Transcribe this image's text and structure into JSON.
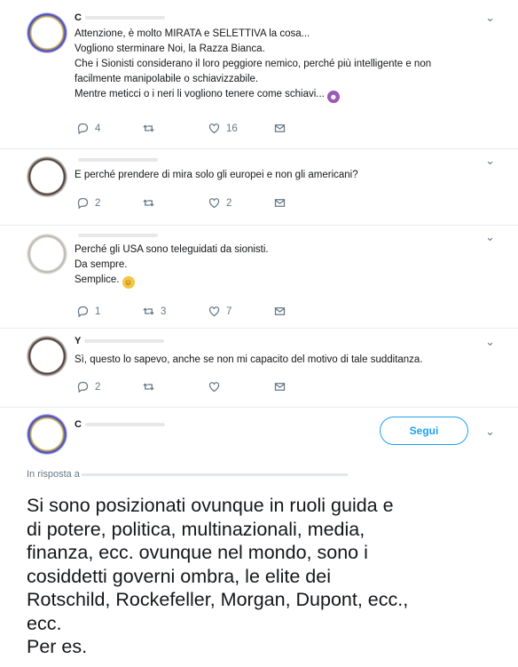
{
  "tweets": [
    {
      "name": "C",
      "lines": [
        "Attenzione, è molto MIRATA e SELETTIVA la cosa...",
        "Vogliono sterminare Noi, la Razza Bianca.",
        "Che i Sionisti considerano il loro peggiore nemico, perché più intelligente e non",
        "facilmente manipolabile o schiavizzabile.",
        "Mentre meticci o i neri li vogliono tenere come schiavi..."
      ],
      "emoji": "devil",
      "replies": "4",
      "retweets": "",
      "likes": "16"
    },
    {
      "name": "",
      "lines": [
        "E perché prendere di mira solo gli europei e non gli americani?"
      ],
      "replies": "2",
      "retweets": "",
      "likes": "2"
    },
    {
      "name": "",
      "lines": [
        "Perché gli USA sono teleguidati da sionisti.",
        "Da sempre.",
        "Semplice."
      ],
      "emoji": "wink",
      "replies": "1",
      "retweets": "3",
      "likes": "7"
    },
    {
      "name": "Y",
      "lines": [
        "Sì, questo lo sapevo, anche se non mi capacito del motivo di tale sudditanza."
      ],
      "replies": "2",
      "retweets": "",
      "likes": ""
    }
  ],
  "main_tweet": {
    "name": "C",
    "follow_label": "Segui",
    "reply_prefix": "In risposta a",
    "lines": [
      "Si sono posizionati ovunque in ruoli guida e",
      "di potere, politica, multinazionali, media,",
      "finanza, ecc. ovunque nel mondo, sono i",
      "cosiddetti governi ombra, le elite dei",
      "Rotschild, Rockefeller, Morgan, Dupont, ecc.,",
      "ecc.",
      "Per es."
    ]
  },
  "icons": {
    "reply": "reply-icon",
    "retweet": "retweet-icon",
    "like": "heart-icon",
    "dm": "envelope-icon",
    "more": "chevron-down-icon"
  },
  "colors": {
    "accent": "#1da1f2",
    "muted": "#657786",
    "text": "#14171a"
  }
}
